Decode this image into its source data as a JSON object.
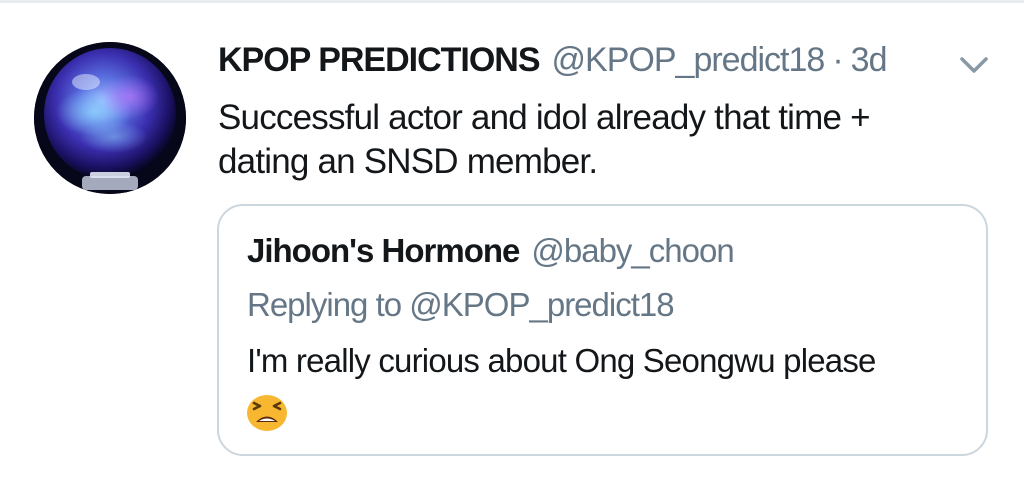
{
  "tweet": {
    "display_name": "KPOP PREDICTIONS",
    "handle": "@KPOP_predict18",
    "separator": "·",
    "time": "3d",
    "text": "Successful actor and idol already that time + dating an SNSD member.",
    "avatar_icon": "crystal-ball",
    "caret_icon": "chevron-down"
  },
  "quote": {
    "display_name": "Jihoon's Hormone",
    "handle": "@baby_choon",
    "replying_prefix": "Replying to",
    "replying_to": "@KPOP_predict18",
    "text": "I'm really curious about Ong Seongwu please",
    "emoji_icon": "tired-face-emoji"
  },
  "colors": {
    "text_primary": "#14171a",
    "text_secondary": "#657786",
    "border": "#ccd6dd",
    "divider": "#e6ecf0",
    "emoji_face": "#f7b731"
  }
}
